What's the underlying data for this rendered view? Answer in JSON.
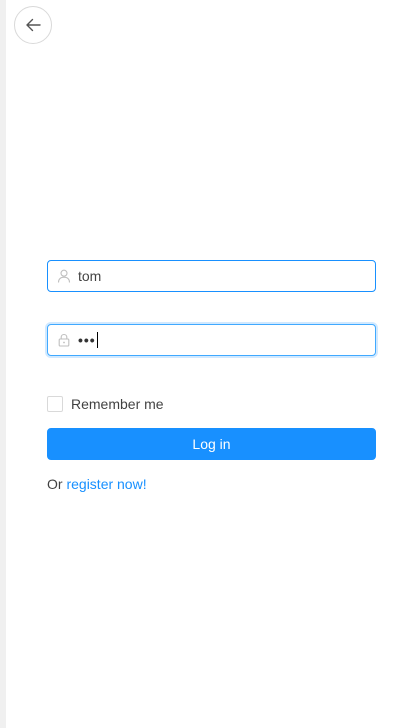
{
  "header": {
    "back_icon": "arrow-left-icon"
  },
  "login_form": {
    "username": {
      "icon": "user-icon",
      "value": "tom"
    },
    "password": {
      "icon": "lock-icon",
      "masked_value": "•••"
    },
    "remember_label": "Remember me",
    "login_label": "Log in",
    "register_prefix": "Or",
    "register_link": "register now!"
  },
  "colors": {
    "primary": "#1890ff",
    "border": "#d9d9d9"
  }
}
